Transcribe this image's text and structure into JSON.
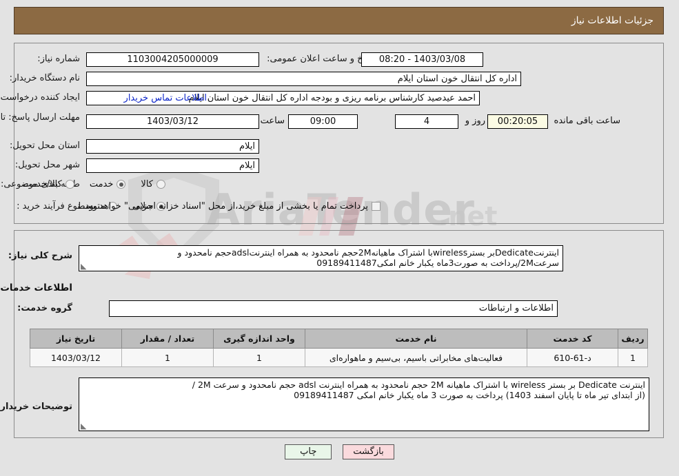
{
  "header": {
    "title": "جزئیات اطلاعات نیاز"
  },
  "watermark": {
    "brand": "AriaTender",
    "suffix": ".net"
  },
  "form": {
    "need_number": {
      "label": "شماره نیاز:",
      "value": "1103004205000009"
    },
    "announce_datetime": {
      "label": "تاریخ و ساعت اعلان عمومی:",
      "value": "1403/03/08 - 08:20"
    },
    "buyer_org": {
      "label": "نام دستگاه خریدار:",
      "value": "اداره کل انتقال خون استان ایلام"
    },
    "requester": {
      "label": "ایجاد کننده درخواست:",
      "value": "احمد عیدصید کارشناس برنامه ریزی و بودجه اداره کل انتقال خون استان ایلام"
    },
    "contact_link": {
      "label": "اطلاعات تماس خریدار"
    },
    "deadline": {
      "label": "مهلت ارسال پاسخ: تا تاریخ:",
      "date": "1403/03/12",
      "time_label": "ساعت",
      "time": "09:00",
      "days": "4",
      "days_label": "روز و",
      "countdown": "00:20:05",
      "countdown_label": "ساعت باقی مانده"
    },
    "delivery_province": {
      "label": "استان محل تحویل:",
      "value": "ایلام"
    },
    "delivery_city": {
      "label": "شهر محل تحویل:",
      "value": "ایلام"
    },
    "category": {
      "label": "طبقه بندی موضوعی:",
      "options": [
        "کالا",
        "خدمت",
        "کالا/خدمت"
      ],
      "selected": "خدمت"
    },
    "purchase_type": {
      "label": "نوع فرآیند خرید :",
      "options": [
        "جزیی",
        "متوسط"
      ],
      "selected": "جزیی",
      "checkbox_label": "پرداخت تمام یا بخشی از مبلغ خرید،از محل \"اسناد خزانه اسلامی\" خواهد بود.",
      "checkbox_checked": false
    },
    "general_description": {
      "label": "شرح کلی نیاز:",
      "line1": "اینترنتDedicateبر بسترwirelessبا اشتراک ماهیانه2Mحجم نامحدود به همراه اینترنتadslحجم نامحدود و",
      "line2": "سرعت2M/پرداخت به صورت3ماه یکبار خانم امکی09189411487"
    },
    "services_section_title": "اطلاعات خدمات مورد نیاز",
    "service_group": {
      "label": "گروه خدمت:",
      "value": "اطلاعات و ارتباطات"
    },
    "buyer_notes": {
      "label": "توضیحات خریدار:",
      "line1": "اینترنت Dedicate بر بستر wireless با اشتراک ماهیانه 2M حجم نامحدود به همراه اینترنت adsl حجم نامحدود و سرعت 2M /",
      "line2": "(از ابتدای تیر ماه تا پایان اسفند 1403) پرداخت به صورت 3 ماه یکبار خانم امکی 09189411487"
    }
  },
  "table": {
    "columns": [
      "ردیف",
      "کد خدمت",
      "نام خدمت",
      "واحد اندازه گیری",
      "تعداد / مقدار",
      "تاریخ نیاز"
    ],
    "rows": [
      {
        "index": "1",
        "code": "د-61-610",
        "name": "فعالیت‌های مخابراتی باسیم، بی‌سیم و ماهواره‌ای",
        "unit": "1",
        "qty": "1",
        "date": "1403/03/12"
      }
    ]
  },
  "buttons": {
    "print": "چاپ",
    "back": "بازگشت"
  },
  "colors": {
    "header_bg": "#8c6a43",
    "page_bg": "#e3e3e3",
    "link": "#0b24c9",
    "timer_bg": "#fbfbe4",
    "btn_print_bg": "#e9f6e9",
    "btn_back_bg": "#fadadd",
    "table_header_bg": "#bdbdbd"
  }
}
